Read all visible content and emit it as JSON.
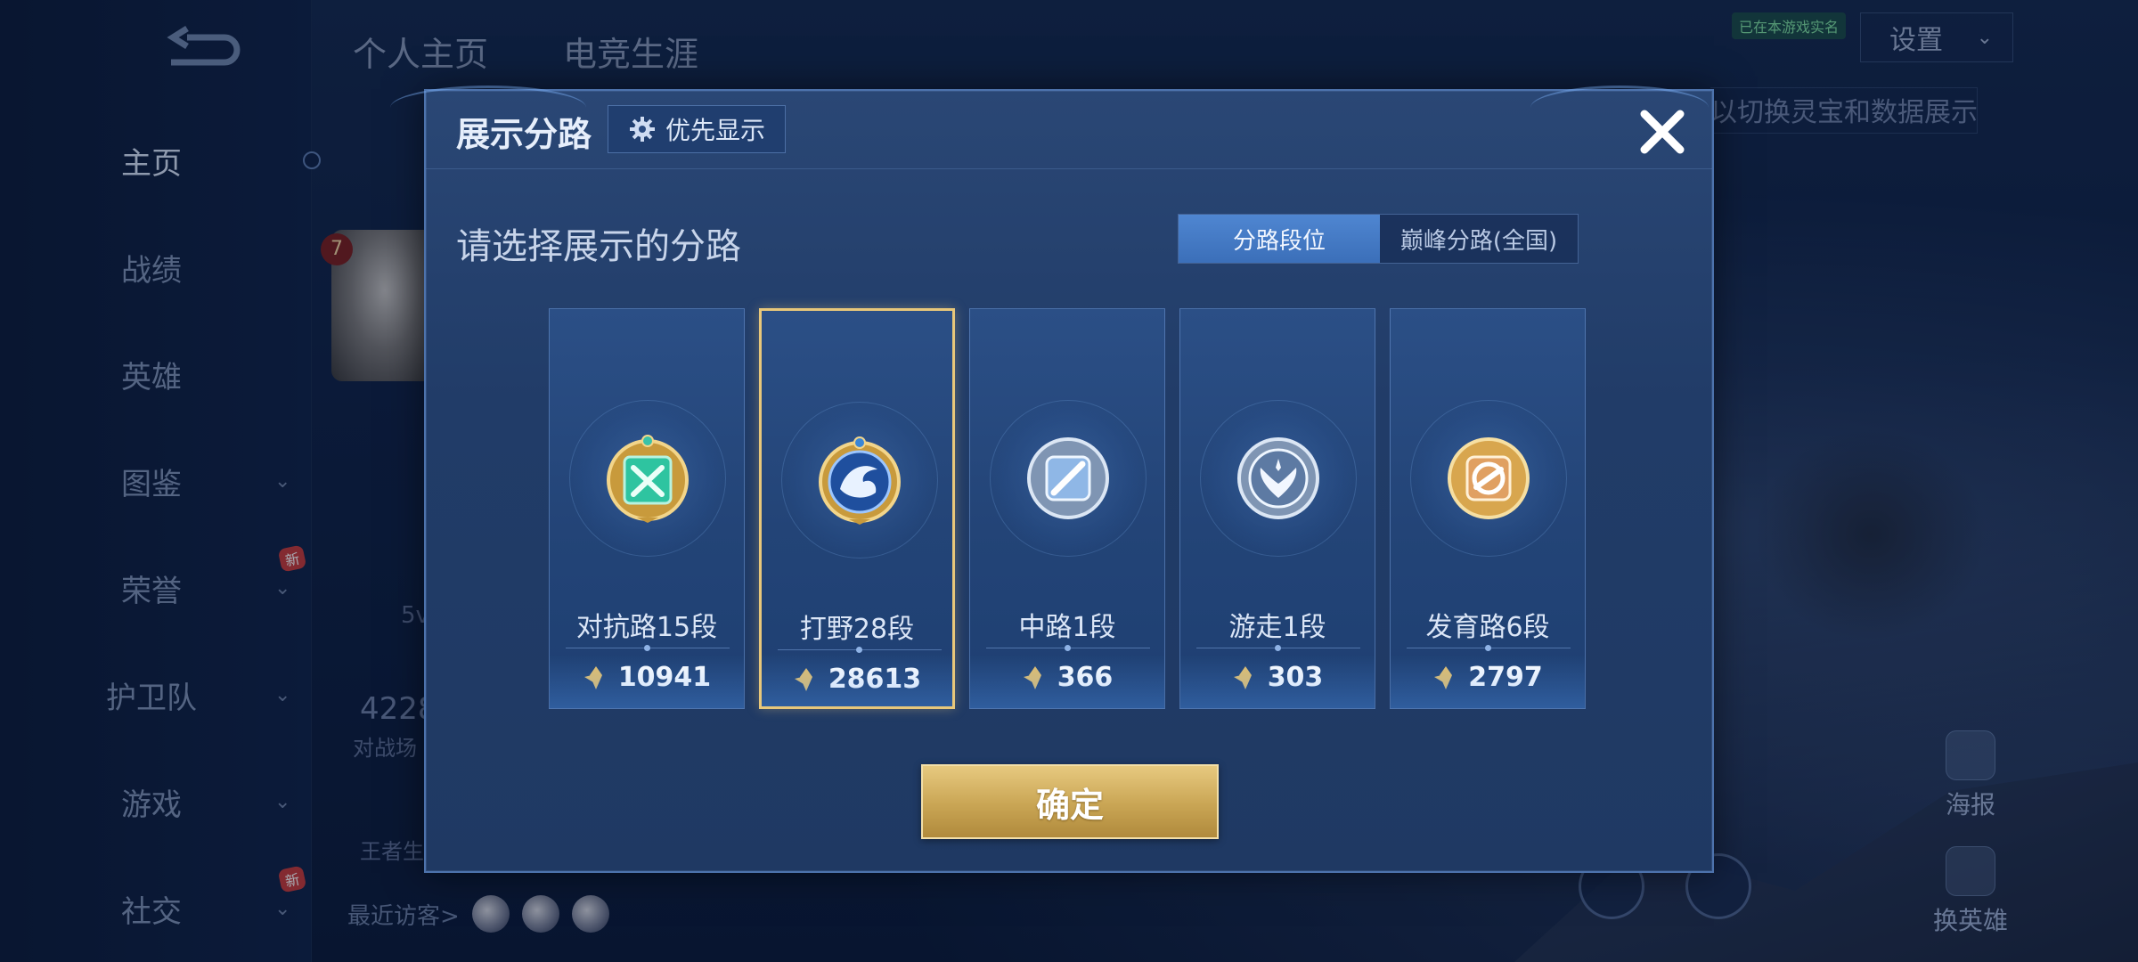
{
  "sidebar": {
    "items": [
      {
        "label": "主页"
      },
      {
        "label": "战绩"
      },
      {
        "label": "英雄"
      },
      {
        "label": "图鉴"
      },
      {
        "label": "荣誉",
        "badge": "新"
      },
      {
        "label": "护卫队"
      },
      {
        "label": "游戏"
      },
      {
        "label": "社交",
        "badge": "新"
      }
    ]
  },
  "header": {
    "tabs": [
      "个人主页",
      "电竞生涯"
    ],
    "settings_label": "设置",
    "tag": "已在本游戏实名",
    "hint": "以切换灵宝和数据展示"
  },
  "background": {
    "level": "7",
    "mode": "5v",
    "count": "4228",
    "count_label": "对战场",
    "game_label": "王者生",
    "visitors_label": "最近访客>",
    "poster_label": "海报",
    "switch_hero_label": "换英雄"
  },
  "modal": {
    "title": "展示分路",
    "priority_label": "优先显示",
    "subtitle": "请选择展示的分路",
    "segment": {
      "options": [
        "分路段位",
        "巅峰分路(全国)"
      ],
      "selected": "分路段位"
    },
    "lanes": [
      {
        "name": "对抗路15段",
        "score": "10941",
        "icon": "clash-lane-emblem-icon",
        "color": "#2ec4a0",
        "selected": false
      },
      {
        "name": "打野28段",
        "score": "28613",
        "icon": "jungle-dragon-emblem-icon",
        "color": "#2a6fc9",
        "selected": true
      },
      {
        "name": "中路1段",
        "score": "366",
        "icon": "mid-lane-emblem-icon",
        "color": "#8fb7e6",
        "selected": false
      },
      {
        "name": "游走1段",
        "score": "303",
        "icon": "roam-wings-emblem-icon",
        "color": "#a9c3e6",
        "selected": false
      },
      {
        "name": "发育路6段",
        "score": "2797",
        "icon": "farm-lane-emblem-icon",
        "color": "#e0a062",
        "selected": false
      }
    ],
    "confirm_label": "确定"
  },
  "colors": {
    "accent_gold": "#e8c77a",
    "segment_active": "#4a80cb",
    "modal_bg": "#24406c"
  }
}
